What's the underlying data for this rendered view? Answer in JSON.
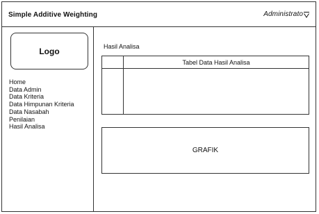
{
  "header": {
    "app_title": "Simple Additive Weighting",
    "admin_label": "Administrato",
    "admin_icon": "chevron-down-icon"
  },
  "sidebar": {
    "logo": "Logo",
    "items": [
      {
        "label": "Home"
      },
      {
        "label": "Data Admin"
      },
      {
        "label": "Data Kriteria"
      },
      {
        "label": "Data Himpunan Kriteria"
      },
      {
        "label": "Data Nasabah"
      },
      {
        "label": "Penilaian"
      },
      {
        "label": "Hasil Analisa"
      }
    ]
  },
  "main": {
    "section_label": "Hasil Analisa",
    "table_title": "Tabel Data Hasil Analisa",
    "chart_label": "GRAFIK"
  }
}
